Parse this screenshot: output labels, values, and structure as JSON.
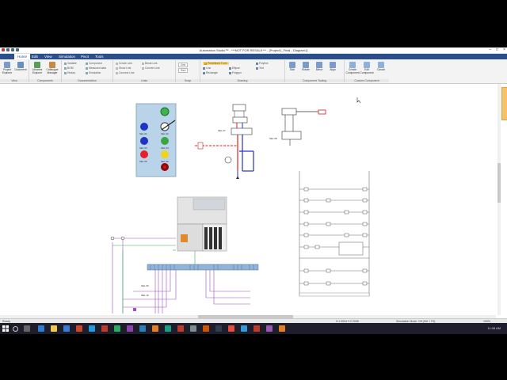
{
  "window": {
    "title": "Automation Studio™ - ***NOT FOR RESALE*** - [Project1_Final - Diagram1]",
    "controls": [
      "–",
      "□",
      "×"
    ]
  },
  "menu": {
    "tabs": [
      "Home",
      "Edit",
      "View",
      "Simulation",
      "Pivot",
      "Tools"
    ],
    "active": "Home"
  },
  "ribbon": {
    "groups": [
      {
        "label": "View",
        "buttons": [
          "Project Explorer",
          "Document"
        ]
      },
      {
        "label": "Components",
        "buttons": [
          "Libraries Explorer",
          "Catalogue Manager"
        ]
      },
      {
        "label": "Documentation",
        "items": [
          "Variable",
          "Component",
          "BOM",
          "Measured data",
          "History",
          "Simulation"
        ]
      },
      {
        "label": "Links",
        "items": [
          "Create Link",
          "Break Link",
          "Show Link",
          "Convert Link",
          "Connect Line"
        ]
      },
      {
        "label": "Snap",
        "items": [
          "Grid",
          "Size"
        ]
      },
      {
        "label": "Drawing",
        "items": [
          "Predefined Form",
          "Line",
          "Rectangle",
          "Ellipse",
          "Polyline",
          "Polygon",
          "Text"
        ]
      },
      {
        "label": "Component Tooling",
        "buttons": [
          "Skin",
          "Rotate",
          "Mirror",
          "Align"
        ]
      },
      {
        "label": "Custom Component",
        "buttons": [
          "Create Component",
          "Edit Component",
          "Cancel"
        ]
      }
    ],
    "grid_value": "Grid",
    "size_value": "Size"
  },
  "diagram": {
    "panel_lights": [
      "green",
      "blue",
      "blue",
      "green",
      "red",
      "yellow",
      "darkred"
    ],
    "labels": [
      "SEL 01",
      "SEL 02",
      "SEL 03",
      "SEL 04",
      "SEL 05",
      "SEL 06",
      "SEL 07",
      "SEL 08",
      "SEL 09",
      "SEL 10"
    ]
  },
  "status": {
    "left": "Ready",
    "coords": "X:1.0004 Y:2.2006",
    "mode": "Simulation Mode: Off (Ctrl + F5)",
    "zoom": "100%"
  },
  "taskbar": {
    "time": "11:08 AM"
  }
}
